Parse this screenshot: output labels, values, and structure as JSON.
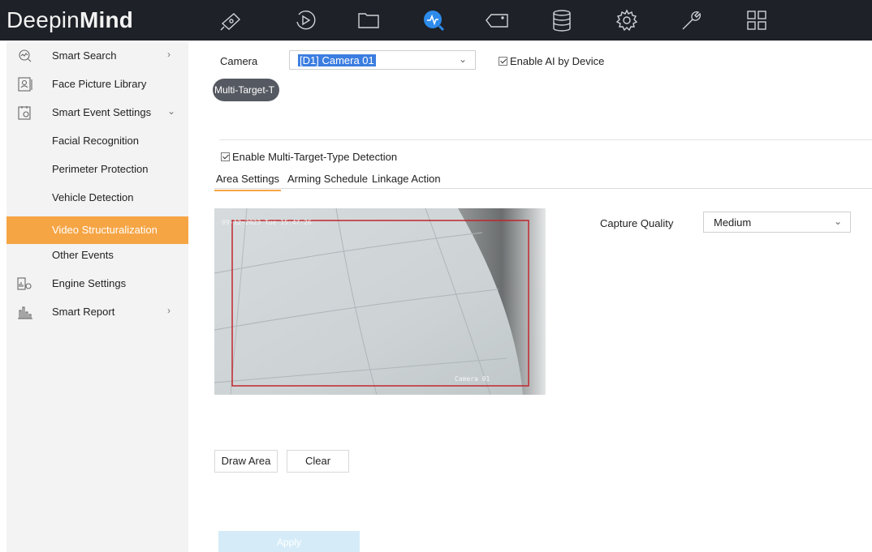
{
  "app": {
    "brand_light": "Deepin",
    "brand_bold": "Mind"
  },
  "topnav": {
    "icons": [
      "camera-icon",
      "playback-icon",
      "folder-icon",
      "smart-analysis-icon",
      "tag-icon",
      "storage-icon",
      "settings-gear-icon",
      "maintenance-wrench-icon",
      "grid-apps-icon"
    ],
    "active_index": 3,
    "accent": "#2d8bea"
  },
  "sidebar": {
    "items": [
      {
        "label": "Smart Search",
        "icon": "smart-search-icon",
        "arrow": "›"
      },
      {
        "label": "Face Picture Library",
        "icon": "face-library-icon",
        "arrow": ""
      },
      {
        "label": "Smart Event Settings",
        "icon": "event-settings-icon",
        "arrow": "⌄"
      },
      {
        "label": "Facial Recognition",
        "icon": "",
        "arrow": ""
      },
      {
        "label": "Perimeter Protection",
        "icon": "",
        "arrow": ""
      },
      {
        "label": "Vehicle Detection",
        "icon": "",
        "arrow": ""
      },
      {
        "label": "Video Structuralization",
        "icon": "",
        "arrow": ""
      },
      {
        "label": "Other Events",
        "icon": "",
        "arrow": ""
      },
      {
        "label": "Engine Settings",
        "icon": "engine-settings-icon",
        "arrow": ""
      },
      {
        "label": "Smart Report",
        "icon": "smart-report-icon",
        "arrow": "›"
      }
    ],
    "active_index": 6,
    "active_color": "#f6a545"
  },
  "main": {
    "camera_label": "Camera",
    "camera_value": "[D1] Camera 01",
    "enable_ai_label": "Enable AI by Device",
    "enable_ai_checked": true,
    "mode_pill": "Multi-Target-T",
    "enable_mtt_label": "Enable Multi-Target-Type Detection",
    "enable_mtt_checked": true,
    "tabs": [
      "Area Settings",
      "Arming Schedule",
      "Linkage Action"
    ],
    "active_tab": 0,
    "video": {
      "osd_time": "09-12-2023 Tue 15:47:26",
      "osd_name": "Camera 01",
      "area_color": "#c0262d"
    },
    "capture_quality_label": "Capture Quality",
    "capture_quality_value": "Medium",
    "draw_area_label": "Draw Area",
    "clear_label": "Clear",
    "apply_label": "Apply"
  }
}
